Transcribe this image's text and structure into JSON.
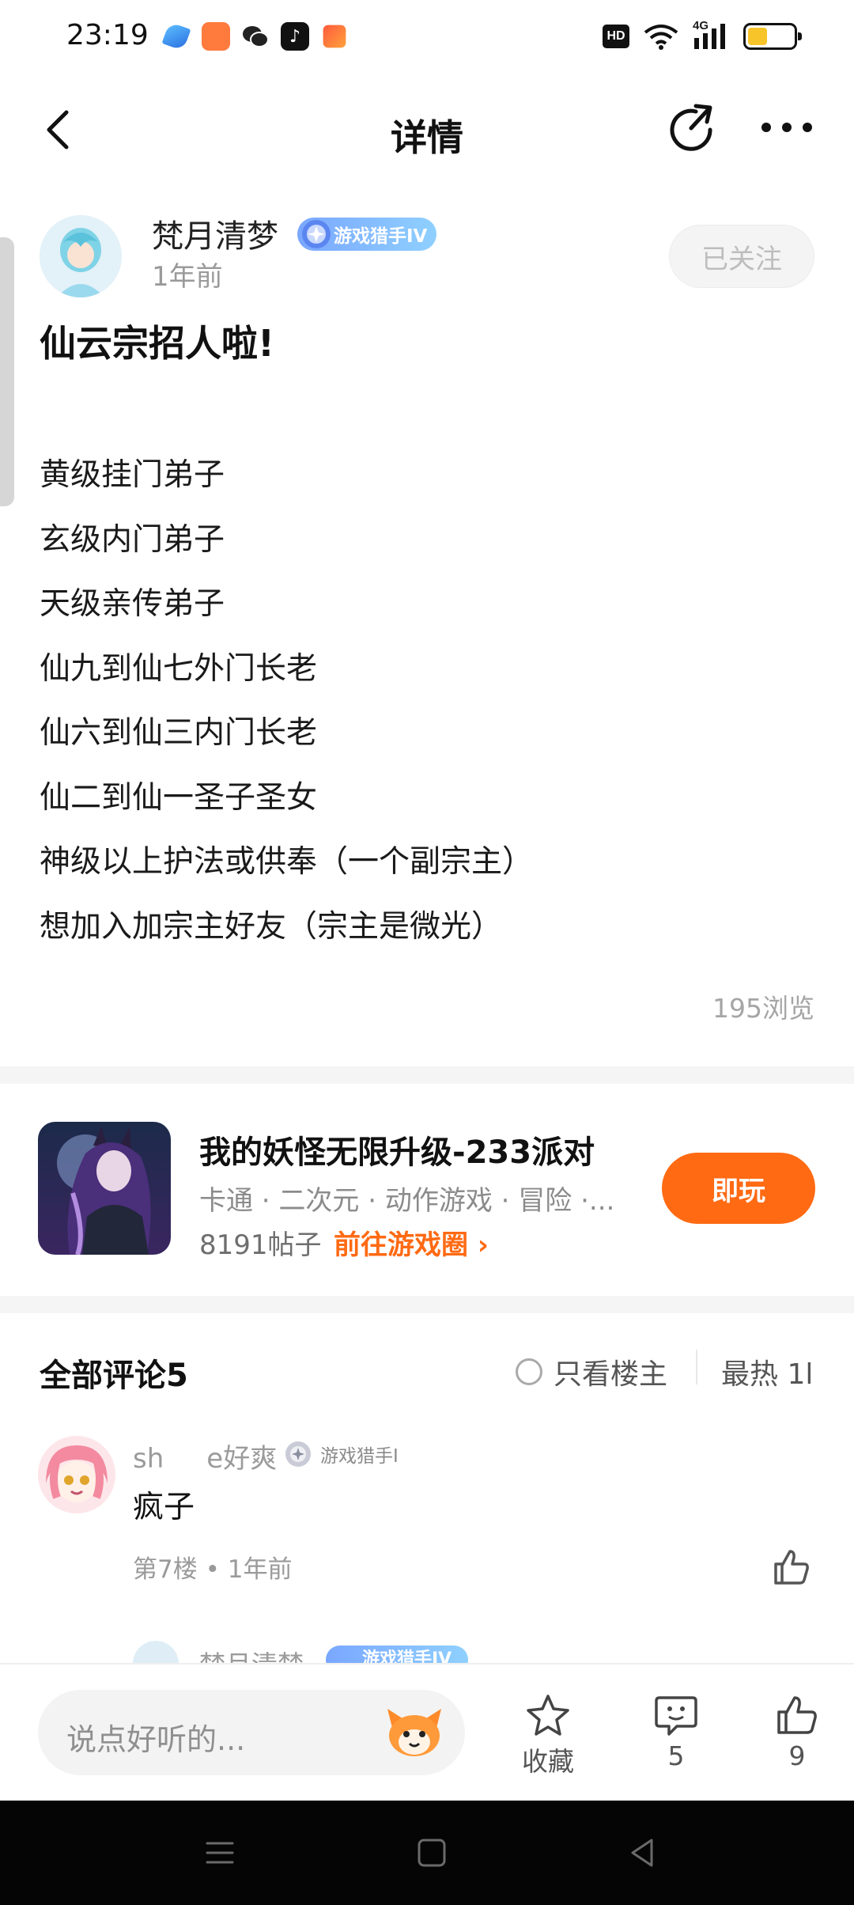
{
  "status_bar": {
    "time": "23:19",
    "hd": "HD",
    "network": "4G",
    "battery_level": 0.42
  },
  "header": {
    "title": "详情"
  },
  "post": {
    "author": "梵月清梦",
    "author_badge": "游戏猎手IV",
    "time": "1年前",
    "follow_label": "已关注",
    "title": "仙云宗招人啦!",
    "lines": [
      "黄级挂门弟子",
      "玄级内门弟子",
      "天级亲传弟子",
      "仙九到仙七外门长老",
      "仙六到仙三内门长老",
      "仙二到仙一圣子圣女",
      "神级以上护法或供奉（一个副宗主）",
      "想加入加宗主好友（宗主是微光）"
    ],
    "views": "195浏览"
  },
  "game_card": {
    "title": "我的妖怪无限升级-233派对",
    "tags": "卡通 · 二次元 · 动作游戏 · 冒险 ·...",
    "posts": "8191帖子",
    "link": "前往游戏圈 ›",
    "play_label": "即玩"
  },
  "comments": {
    "title": "全部评论5",
    "owner_only": "只看楼主",
    "sort": "最热 1l",
    "items": [
      {
        "name": "sh     e好爽",
        "badge": "游戏猎手I",
        "text": "疯子",
        "meta": "第7楼 • 1年前"
      }
    ],
    "reply_peek": {
      "name": "梵月清梦",
      "badge": "游戏猎手IV"
    }
  },
  "bottom_bar": {
    "placeholder": "说点好听的...",
    "favorite_label": "收藏",
    "comment_count": "5",
    "like_count": "9"
  },
  "colors": {
    "accent": "#ff6a13",
    "badge_blue": "#7aa7ff"
  }
}
